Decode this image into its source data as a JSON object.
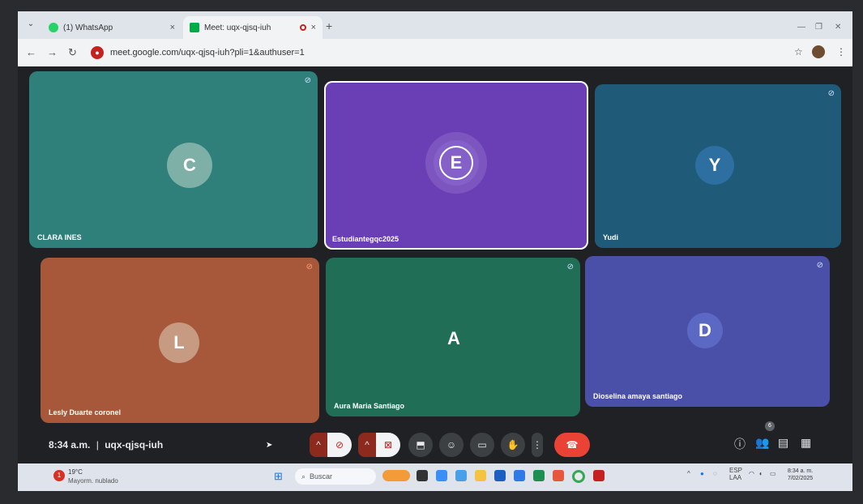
{
  "browser": {
    "tabs": [
      {
        "label": "(1) WhatsApp",
        "icon": "whatsapp-icon",
        "color": "#25d366"
      },
      {
        "label": "Meet: uqx-qjsq-iuh",
        "icon": "meet-icon",
        "color": "#00ac47"
      }
    ],
    "close_glyph": "×",
    "new_tab_glyph": "+",
    "url": "meet.google.com/uqx-qjsq-iuh?pli=1&authuser=1"
  },
  "meeting": {
    "participants": [
      {
        "initial": "C",
        "name": "CLARA INES",
        "bg": "#2f7f7a",
        "avatar": "#7fb0a8",
        "muted": true
      },
      {
        "initial": "E",
        "name": "Estudiantegqc2025",
        "bg": "#6a3fb6",
        "avatar": "#8560c8",
        "muted": false,
        "speaking": true
      },
      {
        "initial": "Y",
        "name": "Yudi",
        "bg": "#1f5a78",
        "avatar": "#2c6fa0",
        "muted": true
      },
      {
        "initial": "L",
        "name": "Lesly Duarte coronel",
        "bg": "#a8583a",
        "avatar": "#c79a82",
        "muted": true
      },
      {
        "initial": "A",
        "name": "Aura Maria Santiago",
        "bg": "#1f6e55",
        "avatar": "#1f6e55",
        "muted": true
      },
      {
        "initial": "D",
        "name": "Dioselina amaya santiago",
        "bg": "#4a4fa8",
        "avatar": "#5b69c4",
        "muted": true
      }
    ],
    "time": "8:34 a.m.",
    "separator": "|",
    "code": "uqx-qjsq-iuh",
    "people_count": "6"
  },
  "taskbar": {
    "temperature": "19°C",
    "weather": "Mayorm. nublado",
    "search_placeholder": "Buscar",
    "lang": "ESP",
    "lang2": "LAA",
    "clock_time": "8:34 a. m.",
    "clock_date": "7/02/2025"
  }
}
